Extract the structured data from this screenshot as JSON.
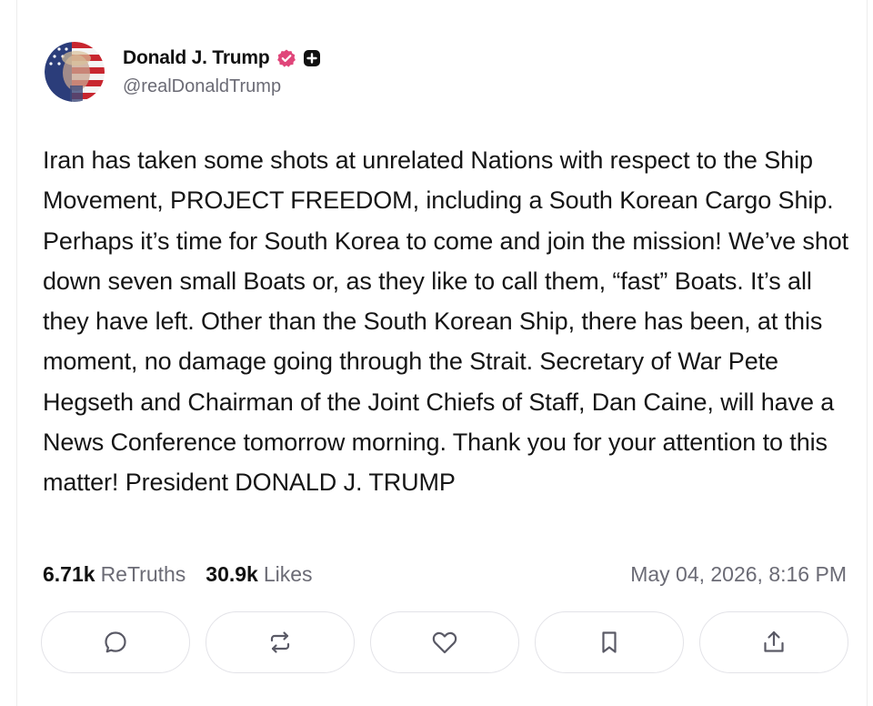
{
  "post": {
    "author": {
      "display_name": "Donald J. Trump",
      "handle": "@realDonaldTrump",
      "avatar_icon": "flag-portrait-avatar",
      "verified_icon": "verified-check-icon",
      "plus_icon": "plus-badge-icon",
      "verified_color": "#e0467a"
    },
    "text": "Iran has taken some shots at unrelated Nations with respect to the Ship Movement, PROJECT FREEDOM, including a South Korean Cargo Ship. Perhaps it’s time for South Korea to come and join the mission! We’ve shot down seven small Boats or, as they like to call them, “fast” Boats. It’s all they have left. Other than the South Korean Ship, there has been, at this moment, no damage going through the Strait. Secretary of War Pete Hegseth and Chairman of the Joint Chiefs of Staff, Dan Caine, will have a News Conference tomorrow morning. Thank you for your attention to this matter! President DONALD J. TRUMP",
    "stats": {
      "retruths_count": "6.71k",
      "retruths_label": "ReTruths",
      "likes_count": "30.9k",
      "likes_label": "Likes"
    },
    "timestamp": "May 04, 2026, 8:16 PM"
  },
  "actions": [
    {
      "name": "reply",
      "icon": "reply-icon"
    },
    {
      "name": "retruth",
      "icon": "retruth-icon"
    },
    {
      "name": "like",
      "icon": "heart-icon"
    },
    {
      "name": "bookmark",
      "icon": "bookmark-icon"
    },
    {
      "name": "share",
      "icon": "share-icon"
    }
  ]
}
